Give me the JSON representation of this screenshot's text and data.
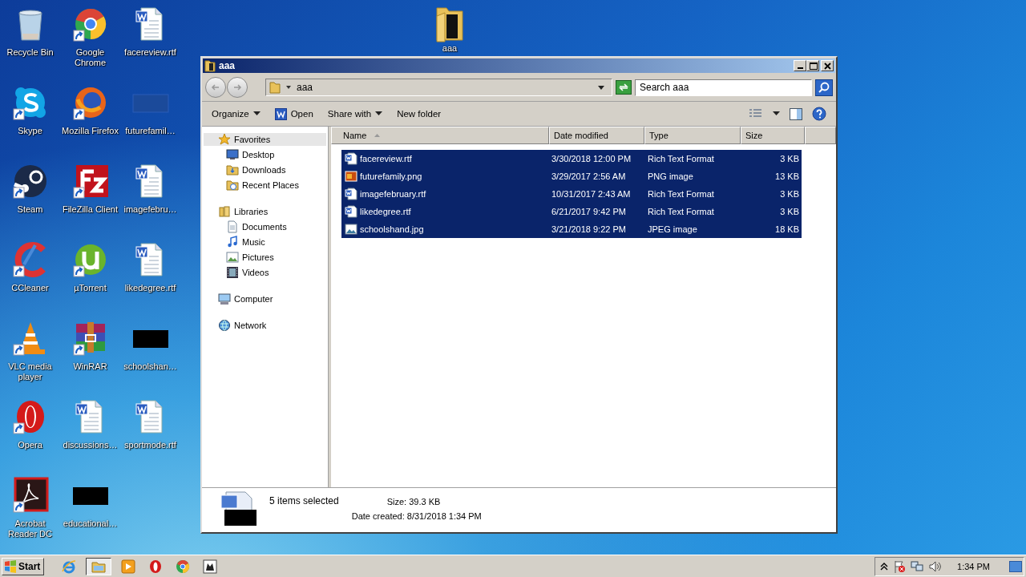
{
  "desktop": {
    "icons": [
      {
        "label": "Recycle Bin",
        "kind": "recycle",
        "shortcut": false
      },
      {
        "label": "Google Chrome",
        "kind": "chrome",
        "shortcut": true
      },
      {
        "label": "facereview.rtf",
        "kind": "word",
        "shortcut": false
      },
      {
        "label": "Skype",
        "kind": "skype",
        "shortcut": true
      },
      {
        "label": "Mozilla Firefox",
        "kind": "firefox",
        "shortcut": true
      },
      {
        "label": "futurefamil…",
        "kind": "bluethumb",
        "shortcut": false
      },
      {
        "label": "Steam",
        "kind": "steam",
        "shortcut": true
      },
      {
        "label": "FileZilla Client",
        "kind": "filezilla",
        "shortcut": true
      },
      {
        "label": "imagefebru…",
        "kind": "word",
        "shortcut": false
      },
      {
        "label": "CCleaner",
        "kind": "ccleaner",
        "shortcut": true
      },
      {
        "label": "µTorrent",
        "kind": "utorrent",
        "shortcut": true
      },
      {
        "label": "likedegree.rtf",
        "kind": "word",
        "shortcut": false
      },
      {
        "label": "VLC media player",
        "kind": "vlc",
        "shortcut": true
      },
      {
        "label": "WinRAR",
        "kind": "winrar",
        "shortcut": true
      },
      {
        "label": "schoolshan…",
        "kind": "blackthumb",
        "shortcut": false
      },
      {
        "label": "Opera",
        "kind": "opera",
        "shortcut": true
      },
      {
        "label": "discussions…",
        "kind": "word",
        "shortcut": false
      },
      {
        "label": "sportmode.rtf",
        "kind": "word",
        "shortcut": false
      },
      {
        "label": "Acrobat Reader DC",
        "kind": "acrobat",
        "shortcut": true
      },
      {
        "label": "educational…",
        "kind": "blackthumb",
        "shortcut": false
      }
    ],
    "folder": {
      "label": "aaa"
    }
  },
  "window": {
    "title": "aaa",
    "address": "aaa",
    "search": {
      "placeholder": "Search aaa"
    },
    "toolbar": [
      {
        "label": "Organize",
        "kind": "menu"
      },
      {
        "label": "Open",
        "kind": "word"
      },
      {
        "label": "Share with",
        "kind": "menu"
      },
      {
        "label": "New folder",
        "kind": "plain"
      }
    ],
    "nav": [
      {
        "label": "Favorites",
        "kind": "star",
        "selected": true,
        "children": [
          {
            "label": "Desktop",
            "kind": "desktop",
            "selected": false
          },
          {
            "label": "Downloads",
            "kind": "folder",
            "selected": false
          },
          {
            "label": "Recent Places",
            "kind": "recent",
            "selected": false
          }
        ]
      },
      {
        "label": "Libraries",
        "kind": "library",
        "selected": false,
        "children": [
          {
            "label": "Documents",
            "kind": "document",
            "selected": false
          },
          {
            "label": "Music",
            "kind": "music",
            "selected": false
          },
          {
            "label": "Pictures",
            "kind": "pictures",
            "selected": false
          },
          {
            "label": "Videos",
            "kind": "videos",
            "selected": false
          }
        ]
      },
      {
        "label": "Computer",
        "kind": "computer",
        "selected": false
      },
      {
        "label": "Network",
        "kind": "network",
        "selected": false
      }
    ],
    "columns": [
      {
        "label": "Name",
        "sorted": true
      },
      {
        "label": "Date modified",
        "sorted": false
      },
      {
        "label": "Type",
        "sorted": false
      },
      {
        "label": "Size",
        "sorted": false
      }
    ],
    "files": [
      {
        "name": "facereview.rtf",
        "kind": "word",
        "date": "3/30/2018 12:00 PM",
        "type": "Rich Text Format",
        "size": "3 KB",
        "selected": true
      },
      {
        "name": "futurefamily.png",
        "kind": "png",
        "date": "3/29/2017 2:56 AM",
        "type": "PNG image",
        "size": "13 KB",
        "selected": true
      },
      {
        "name": "imagefebruary.rtf",
        "kind": "word",
        "date": "10/31/2017 2:43 AM",
        "type": "Rich Text Format",
        "size": "3 KB",
        "selected": true
      },
      {
        "name": "likedegree.rtf",
        "kind": "word",
        "date": "6/21/2017 9:42 PM",
        "type": "Rich Text Format",
        "size": "3 KB",
        "selected": true
      },
      {
        "name": "schoolshand.jpg",
        "kind": "jpg",
        "date": "3/21/2018 9:22 PM",
        "type": "JPEG image",
        "size": "18 KB",
        "selected": true
      }
    ],
    "details": {
      "summary": "5 items selected",
      "size": "Size: 39.3 KB",
      "created": "Date created: 8/31/2018 1:34 PM"
    }
  },
  "taskbar": {
    "start": "Start",
    "apps": [
      {
        "kind": "ie",
        "active": false
      },
      {
        "kind": "explorer",
        "active": true
      },
      {
        "kind": "media",
        "active": false
      },
      {
        "kind": "opera",
        "active": false
      },
      {
        "kind": "chrome",
        "active": false
      },
      {
        "kind": "window",
        "active": false
      }
    ],
    "clock": "1:34 PM"
  }
}
